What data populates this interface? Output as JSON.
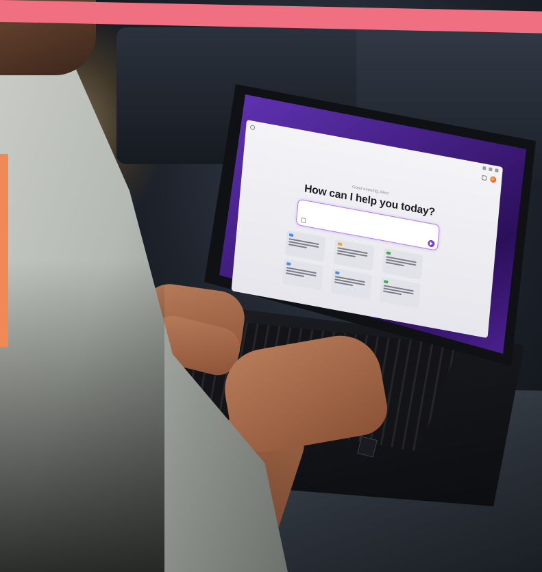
{
  "brand_colors": {
    "top_band": "#f07082",
    "side_band": "#f08a55",
    "accent_purple": "#7b3fe4"
  },
  "screen_app": {
    "greeting": "Good evening, Alex!",
    "headline": "How can I help you today?",
    "prompt_placeholder": "",
    "suggestion_icon_colors": [
      "#4a8ae8",
      "#e8a33a",
      "#3aa85a",
      "#4a8ae8",
      "#4a8ae8",
      "#3aa85a"
    ]
  }
}
